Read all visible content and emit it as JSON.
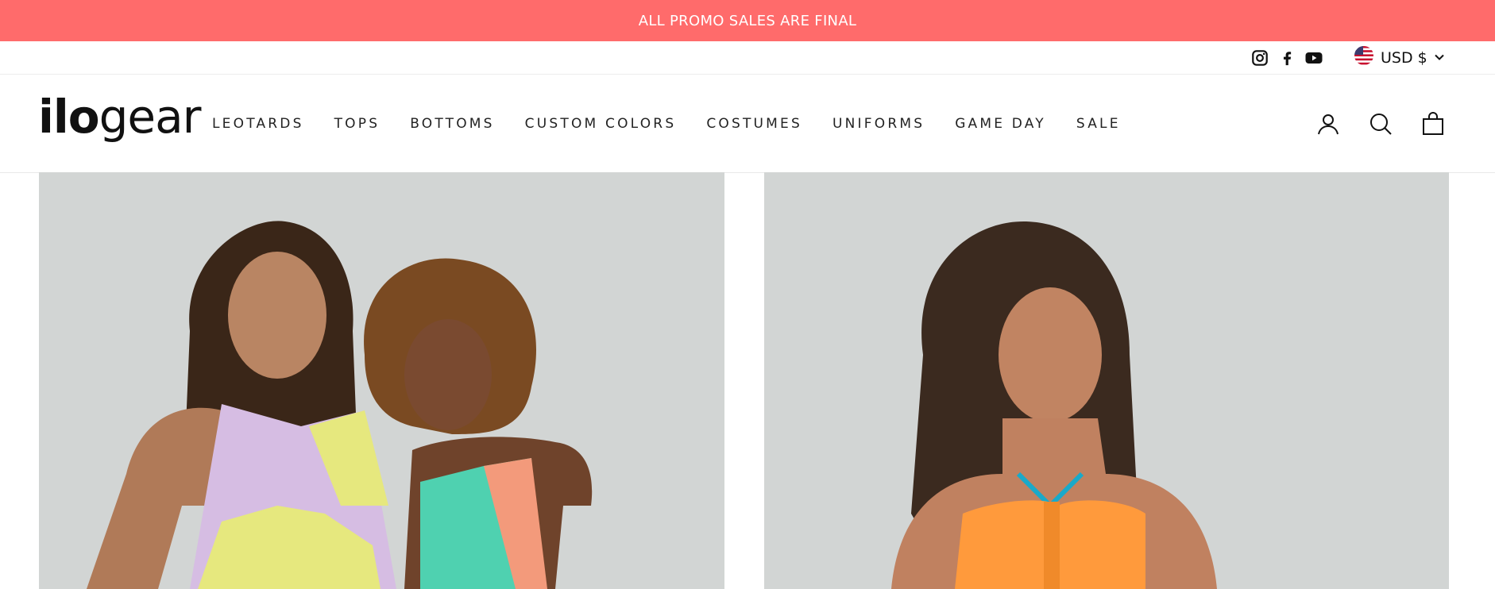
{
  "promo": {
    "text": "ALL PROMO SALES ARE FINAL"
  },
  "utility": {
    "social": [
      {
        "name": "instagram-icon",
        "label": "Instagram"
      },
      {
        "name": "facebook-icon",
        "label": "Facebook"
      },
      {
        "name": "youtube-icon",
        "label": "YouTube"
      }
    ],
    "currency": {
      "label": "USD $",
      "flag": "us-flag-icon"
    }
  },
  "header": {
    "logo": {
      "part1": "ilo",
      "part2": "gear"
    },
    "nav": [
      {
        "label": "LEOTARDS"
      },
      {
        "label": "TOPS"
      },
      {
        "label": "BOTTOMS"
      },
      {
        "label": "CUSTOM COLORS"
      },
      {
        "label": "COSTUMES"
      },
      {
        "label": "UNIFORMS"
      },
      {
        "label": "GAME DAY"
      },
      {
        "label": "SALE"
      }
    ],
    "icons": [
      {
        "name": "account-icon"
      },
      {
        "name": "search-icon"
      },
      {
        "name": "cart-icon"
      }
    ]
  },
  "products": [
    {
      "image": "two-girls-in-colorblock-leotards",
      "colors": [
        "#d6bde3",
        "#e6e87e",
        "#4fd1b0",
        "#f39a7b"
      ]
    },
    {
      "image": "girl-in-orange-halter-top",
      "colors": [
        "#ff9a3c",
        "#1aa9c9"
      ]
    }
  ],
  "colors": {
    "promo": "#ff6b6b",
    "text": "#111111",
    "image_bg": "#d2d5d4"
  }
}
